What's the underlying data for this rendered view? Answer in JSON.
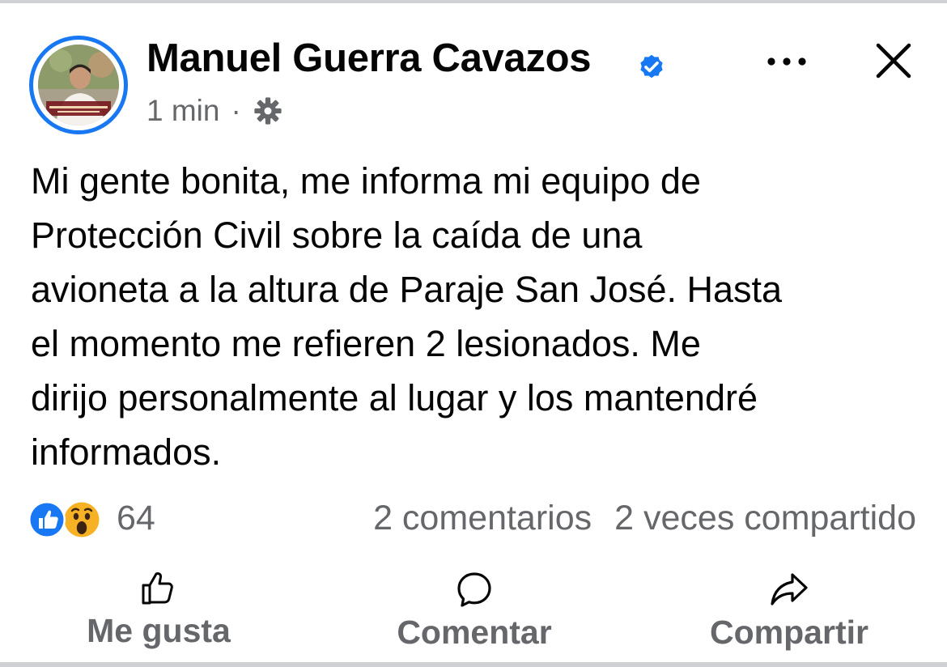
{
  "post": {
    "author": "Manuel Guerra Cavazos",
    "time": "1 min",
    "separator": "·",
    "text": "Mi gente bonita, me informa mi equipo de\nProtección Civil sobre la caída de una\navioneta a la altura de Paraje San José. Hasta\nel momento me refieren 2 lesionados. Me\ndirijo personalmente al lugar y los mantendré\ninformados.",
    "avatar_caption": "MANUEL GUERRA CAVAZOS"
  },
  "stats": {
    "reaction_count": "64",
    "comments": "2 comentarios",
    "shares": "2 veces compartido"
  },
  "actions": {
    "like": "Me gusta",
    "comment": "Comentar",
    "share": "Compartir"
  },
  "icons": {
    "verified": "verified-badge-icon",
    "privacy": "gear-icon",
    "more": "more-dots-icon",
    "close": "close-icon",
    "reaction_like": "like-reaction-icon",
    "reaction_wow": "wow-reaction-icon"
  },
  "colors": {
    "accent": "#1877f2",
    "text_primary": "#050505",
    "text_secondary": "#65676b",
    "divider": "#ced0d4"
  }
}
